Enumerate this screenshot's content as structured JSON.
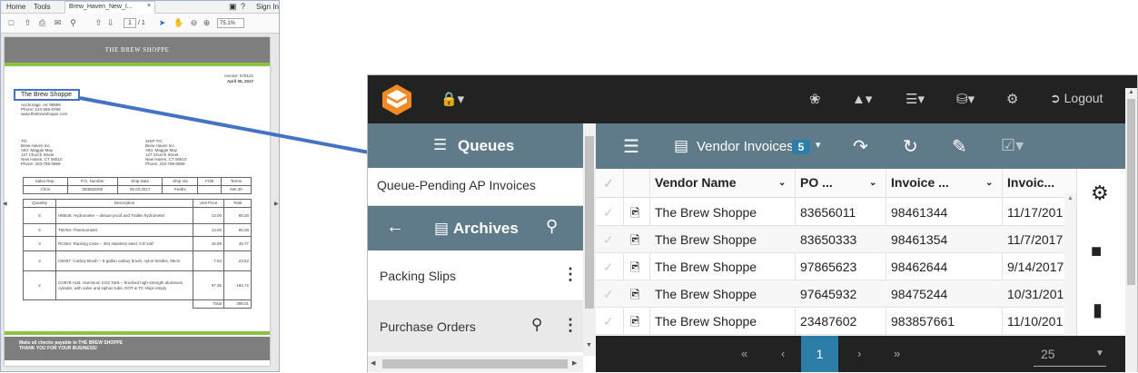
{
  "pdf": {
    "menu": {
      "home": "Home",
      "tools": "Tools",
      "tab": "Brew_Haven_New_I...",
      "close": "×",
      "signin": "Sign In"
    },
    "toolbar": {
      "page": "1",
      "pages": "/ 1",
      "zoom": "75.1%"
    },
    "doc": {
      "company": "THE BREW SHOPPE",
      "invoice": "Invoice: 578121",
      "date": "April 05, 2017",
      "vendor_name": "The Brew Shoppe",
      "vendor_addr": [
        "Anchorage, AK 99999",
        "Phone: 123-555-6789",
        "www.thebrewshoppe.com"
      ],
      "to_label": "TO:",
      "to_lines": [
        "Brew Haven Inc.",
        "Attn: Maggie May",
        "127 Church Street",
        "New Haven, CT 06510",
        "Phone: 203-789-0869"
      ],
      "shipto_label": "SHIP TO:",
      "shipto_lines": [
        "Brew Haven Inc.",
        "Attn: Maggie May",
        "127 Church Street",
        "New Haven, CT 06510",
        "Phone: 203-789-0869"
      ],
      "order_headers": [
        "Sales Rep.",
        "P.O. Number",
        "Ship Date",
        "Ship Via",
        "FOB",
        "Terms"
      ],
      "order_values": [
        "Chris",
        "083602008",
        "06.03.2017",
        "FedEx",
        "",
        "Net 30"
      ],
      "item_headers": [
        "Quantity",
        "Description",
        "Unit Price",
        "Total"
      ],
      "items": [
        {
          "q": "5",
          "d": "HM548: Hydrometer – deluxe proof and Tralles hydrometer",
          "p": "13.00",
          "t": "65.00"
        },
        {
          "q": "5",
          "d": "TM784: Thermometer",
          "p": "13.00",
          "t": "65.00"
        },
        {
          "q": "3",
          "d": "RC654: Racking Cane – 304 stainless steel, 0.5\"x26\"",
          "p": "16.59",
          "t": "49.77"
        },
        {
          "q": "3",
          "d": "CB497: Carboy Brush – 6-gallon carboy brush, nylon bristles, 66cm",
          "p": "7.84",
          "t": "23.52"
        },
        {
          "q": "2",
          "d": "CO678-ALB: Aluminum CO2 Tank – brushed high-strength aluminum cylinder, with valve and siphon tube, DOT & TC ships empty",
          "p": "97.36",
          "t": "194.72"
        }
      ],
      "total_label": "Total",
      "total": "398.01",
      "footer1": "Make all checks payable to THE BREW SHOPPE",
      "footer2": "THANK YOU FOR YOUR BUSINESS!"
    }
  },
  "app": {
    "topbar": {
      "logout": "Logout"
    },
    "left": {
      "queues_title": "Queues",
      "queue_item": "Queue-Pending AP Invoices",
      "archives_title": "Archives",
      "archive_items": [
        "Packing Slips",
        "Purchase Orders"
      ]
    },
    "main": {
      "title": "Vendor Invoices",
      "badge": "5",
      "columns": [
        "Vendor Name",
        "PO ...",
        "Invoice ...",
        "Invoic..."
      ],
      "rows": [
        [
          "The Brew Shoppe",
          "83656011",
          "98461344",
          "11/17/201"
        ],
        [
          "The Brew Shoppe",
          "83650333",
          "98461354",
          "11/7/2017"
        ],
        [
          "The Brew Shoppe",
          "97865623",
          "98462644",
          "9/14/2017"
        ],
        [
          "The Brew Shoppe",
          "97645932",
          "98475244",
          "10/31/201"
        ],
        [
          "The Brew Shoppe",
          "23487602",
          "983857661",
          "11/10/201"
        ]
      ]
    },
    "pager": {
      "first": "«",
      "prev": "‹",
      "current": "1",
      "next": "›",
      "last": "»",
      "page_size": "25"
    },
    "colors": {
      "topbar": "#222222",
      "header": "#5f7a89",
      "accent": "#2c7ea8",
      "highlight": "#4472c4"
    }
  }
}
